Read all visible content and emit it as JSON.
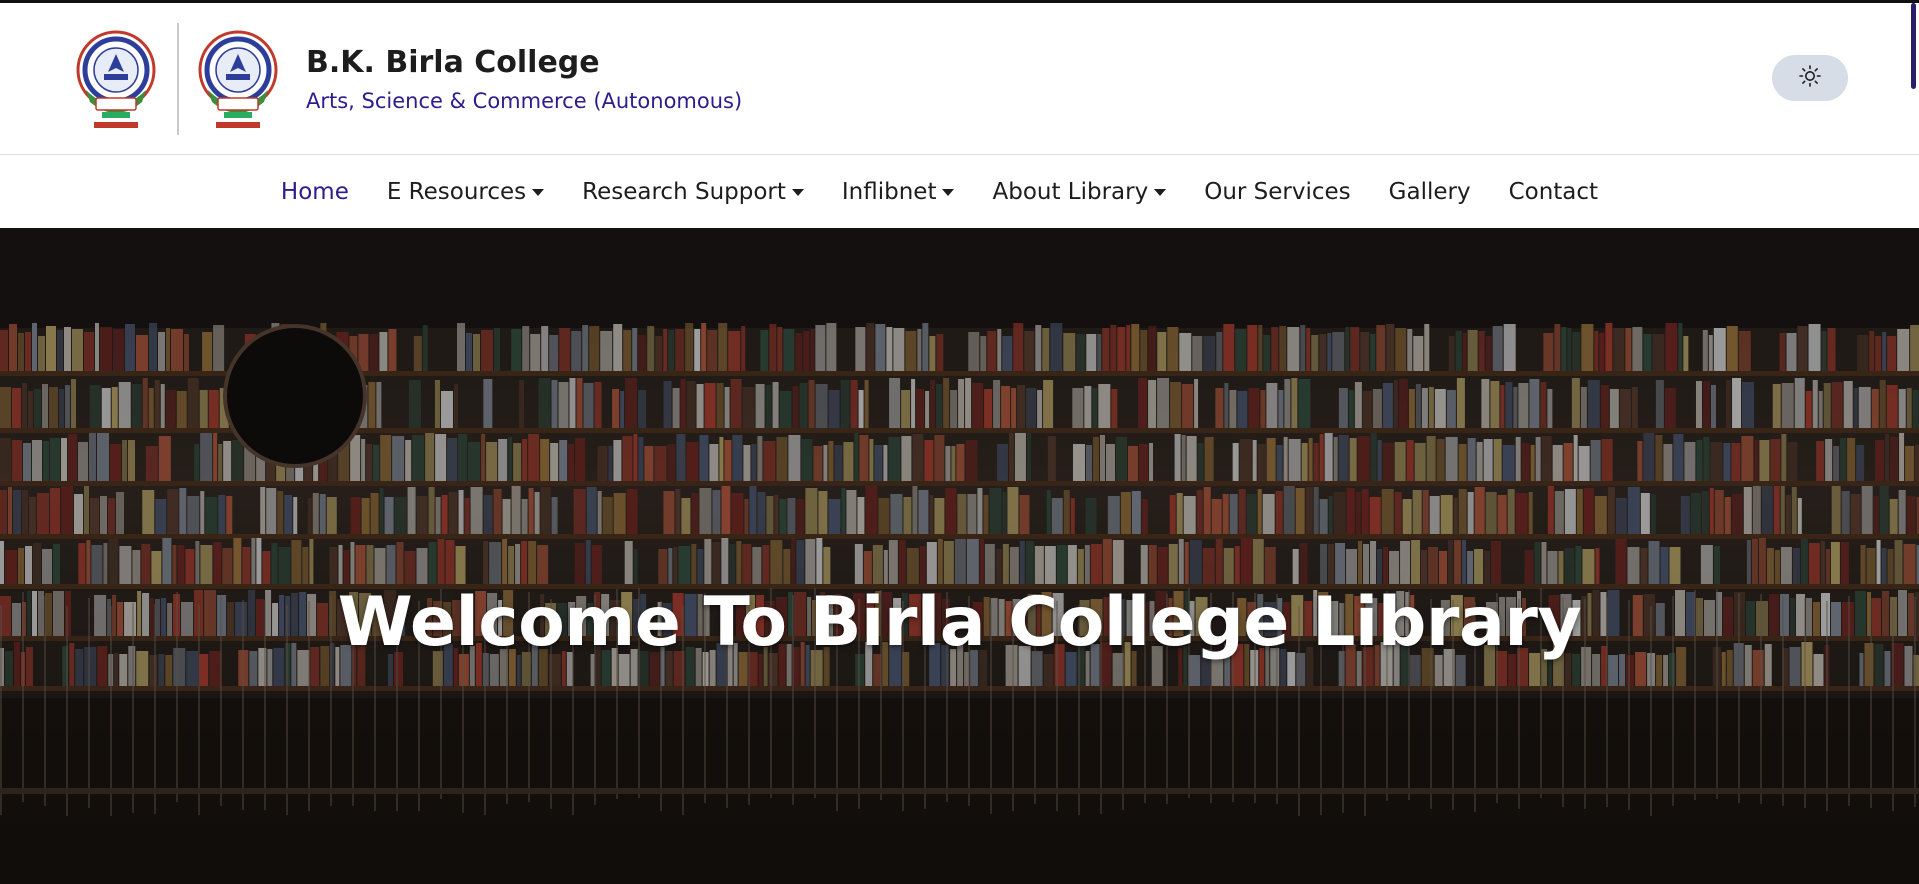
{
  "header": {
    "title": "B.K. Birla College",
    "subtitle": "Arts, Science & Commerce (Autonomous)",
    "logos": [
      "college-seal-icon",
      "college-seal-icon"
    ],
    "theme_toggle_icon": "sun-icon"
  },
  "nav": {
    "items": [
      {
        "label": "Home",
        "dropdown": false,
        "active": true
      },
      {
        "label": "E Resources",
        "dropdown": true,
        "active": false
      },
      {
        "label": "Research Support",
        "dropdown": true,
        "active": false
      },
      {
        "label": "Inflibnet",
        "dropdown": true,
        "active": false
      },
      {
        "label": "About Library",
        "dropdown": true,
        "active": false
      },
      {
        "label": "Our Services",
        "dropdown": false,
        "active": false
      },
      {
        "label": "Gallery",
        "dropdown": false,
        "active": false
      },
      {
        "label": "Contact",
        "dropdown": false,
        "active": false
      }
    ]
  },
  "hero": {
    "title": "Welcome To Birla College Library",
    "background": "library-bookshelves-image"
  },
  "colors": {
    "accent": "#2c1d8c",
    "text": "#1d1d1d",
    "toggle_bg": "#d6dde6"
  }
}
